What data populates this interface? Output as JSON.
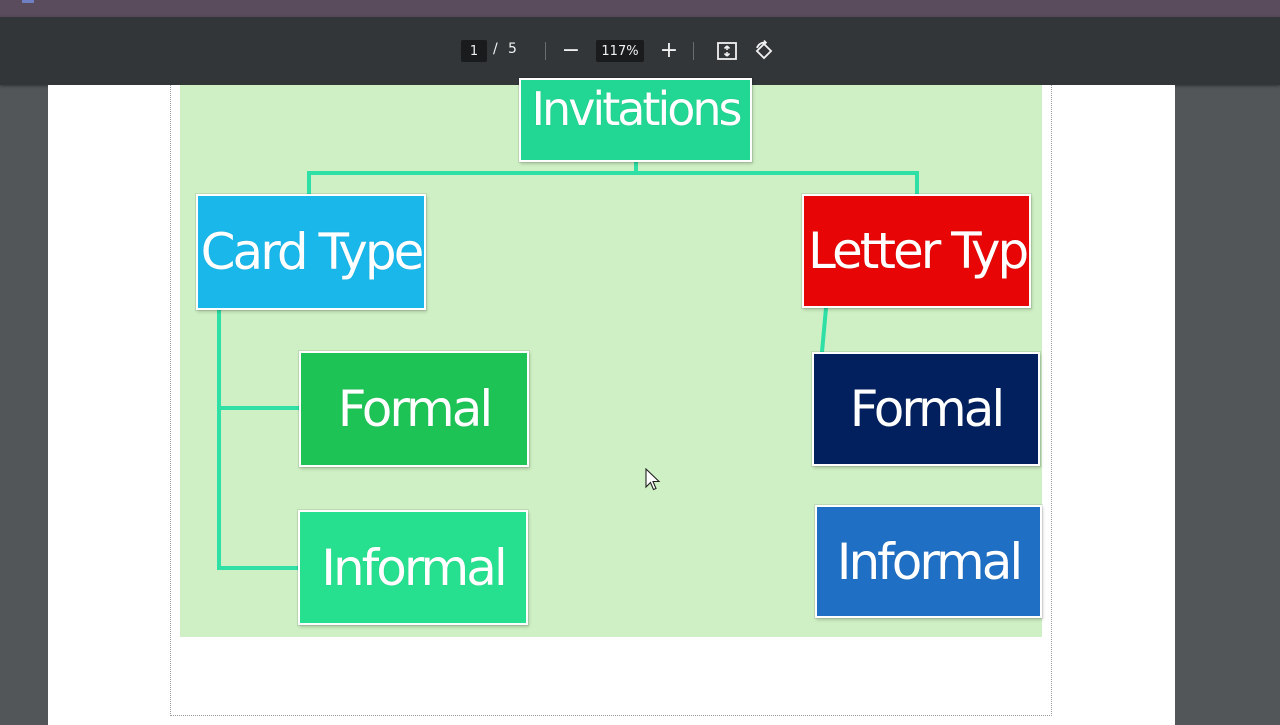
{
  "toolbar": {
    "page_current": "1",
    "page_separator": "/",
    "page_total": "5",
    "zoom_out_symbol": "−",
    "zoom_level": "117%",
    "zoom_in_symbol": "+",
    "icons": [
      "fit-to-page-icon",
      "rotate-icon"
    ]
  },
  "diagram": {
    "root": "Invitations",
    "branches": [
      {
        "label": "Card Type",
        "color": "#19b7ea",
        "children": [
          {
            "label": "Formal",
            "color": "#1ec355"
          },
          {
            "label": "Informal",
            "color": "#26e08f"
          }
        ]
      },
      {
        "label": "Letter Type",
        "color": "#e70505",
        "children": [
          {
            "label": "Formal",
            "color": "#03205e"
          },
          {
            "label": "Informal",
            "color": "#1f6fc4"
          }
        ]
      }
    ],
    "root_color": "#22d693",
    "connector_color": "#2ee0a6",
    "background_color": "#cff0c4"
  }
}
